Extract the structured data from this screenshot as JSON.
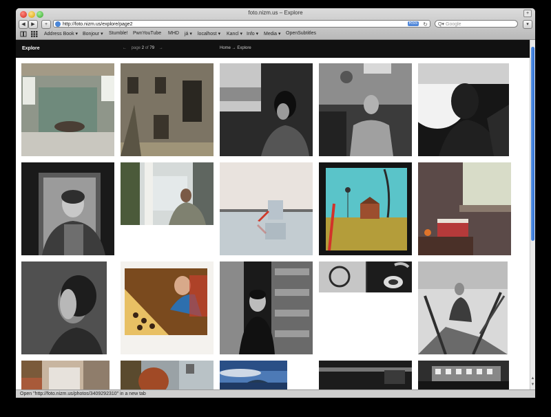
{
  "window": {
    "title": "foto.nizm.us – Explore"
  },
  "toolbar": {
    "back_label": "◀",
    "forward_label": "▶",
    "add_label": "+",
    "url": "http://foto.nizm.us/explore/page2",
    "rss_label": "RSS",
    "reload_label": "↻",
    "search_placeholder": "Google",
    "search_icon_label": "Q▾",
    "menu_label": "▾"
  },
  "bookmarks": [
    {
      "label": "Address Book ▾"
    },
    {
      "label": "Bonjour ▾"
    },
    {
      "label": "Stumble!"
    },
    {
      "label": "PwnYouTube"
    },
    {
      "label": "MHD"
    },
    {
      "label": "já ▾"
    },
    {
      "label": "localhost ▾"
    },
    {
      "label": "Kancl ▾"
    },
    {
      "label": "Info ▾"
    },
    {
      "label": "Media ▾"
    },
    {
      "label": "OpenSubtitles"
    }
  ],
  "site_header": {
    "section": "Explore",
    "prev_label": "←",
    "page_prefix": "page",
    "page_current": "2",
    "page_of": "of",
    "page_total": "79",
    "next_label": "→",
    "breadcrumb": "Home → Explore"
  },
  "status": {
    "text": "Open \"http://foto.nizm.us/photos/3409292310\" in a new tab"
  }
}
